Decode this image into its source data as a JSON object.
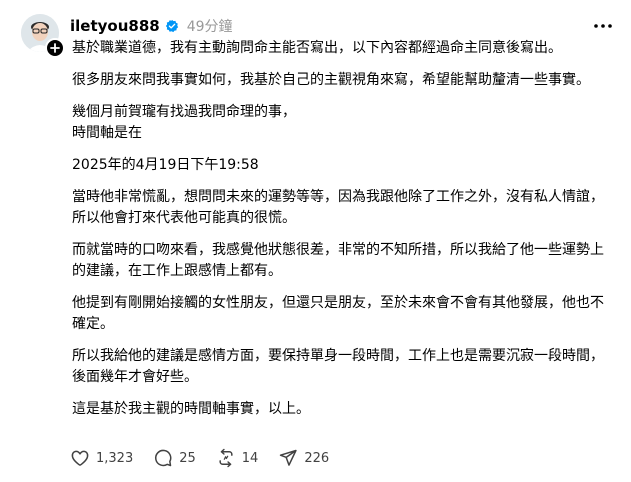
{
  "post": {
    "username": "iletyou888",
    "timestamp": "49分鐘",
    "paragraphs": [
      "基於職業道德，我有主動詢問命主能否寫出，以下內容都經過命主同意後寫出。",
      "很多朋友來問我事實如何，我基於自己的主觀視角來寫，希望能幫助釐清一些事實。",
      "幾個月前賀瓏有找過我問命理的事，\n時間軸是在",
      "2025年的4月19日下午19:58",
      "當時他非常慌亂，想問問未來的運勢等等，因為我跟他除了工作之外，沒有私人情誼，所以他會打來代表他可能真的很慌。",
      "而就當時的口吻來看，我感覺他狀態很差，非常的不知所措，所以我給了他一些運勢上的建議，在工作上跟感情上都有。",
      "他提到有剛開始接觸的女性朋友，但還只是朋友，至於未來會不會有其他發展，他也不確定。",
      "所以我給他的建議是感情方面，要保持單身一段時間，工作上也是需要沉寂一段時間，後面幾年才會好些。",
      "這是基於我主觀的時間軸事實，以上。"
    ]
  },
  "actions": {
    "likes": "1,323",
    "comments": "25",
    "reposts": "14",
    "shares": "226"
  },
  "icons": {
    "verified": "verified-badge-icon",
    "more": "more-horizontal-icon",
    "like": "heart-icon",
    "comment": "comment-bubble-icon",
    "repost": "repost-icon",
    "share": "send-icon",
    "follow": "plus-icon"
  },
  "colors": {
    "verified": "#0095f6",
    "muted": "#999999",
    "icon": "#424242"
  }
}
